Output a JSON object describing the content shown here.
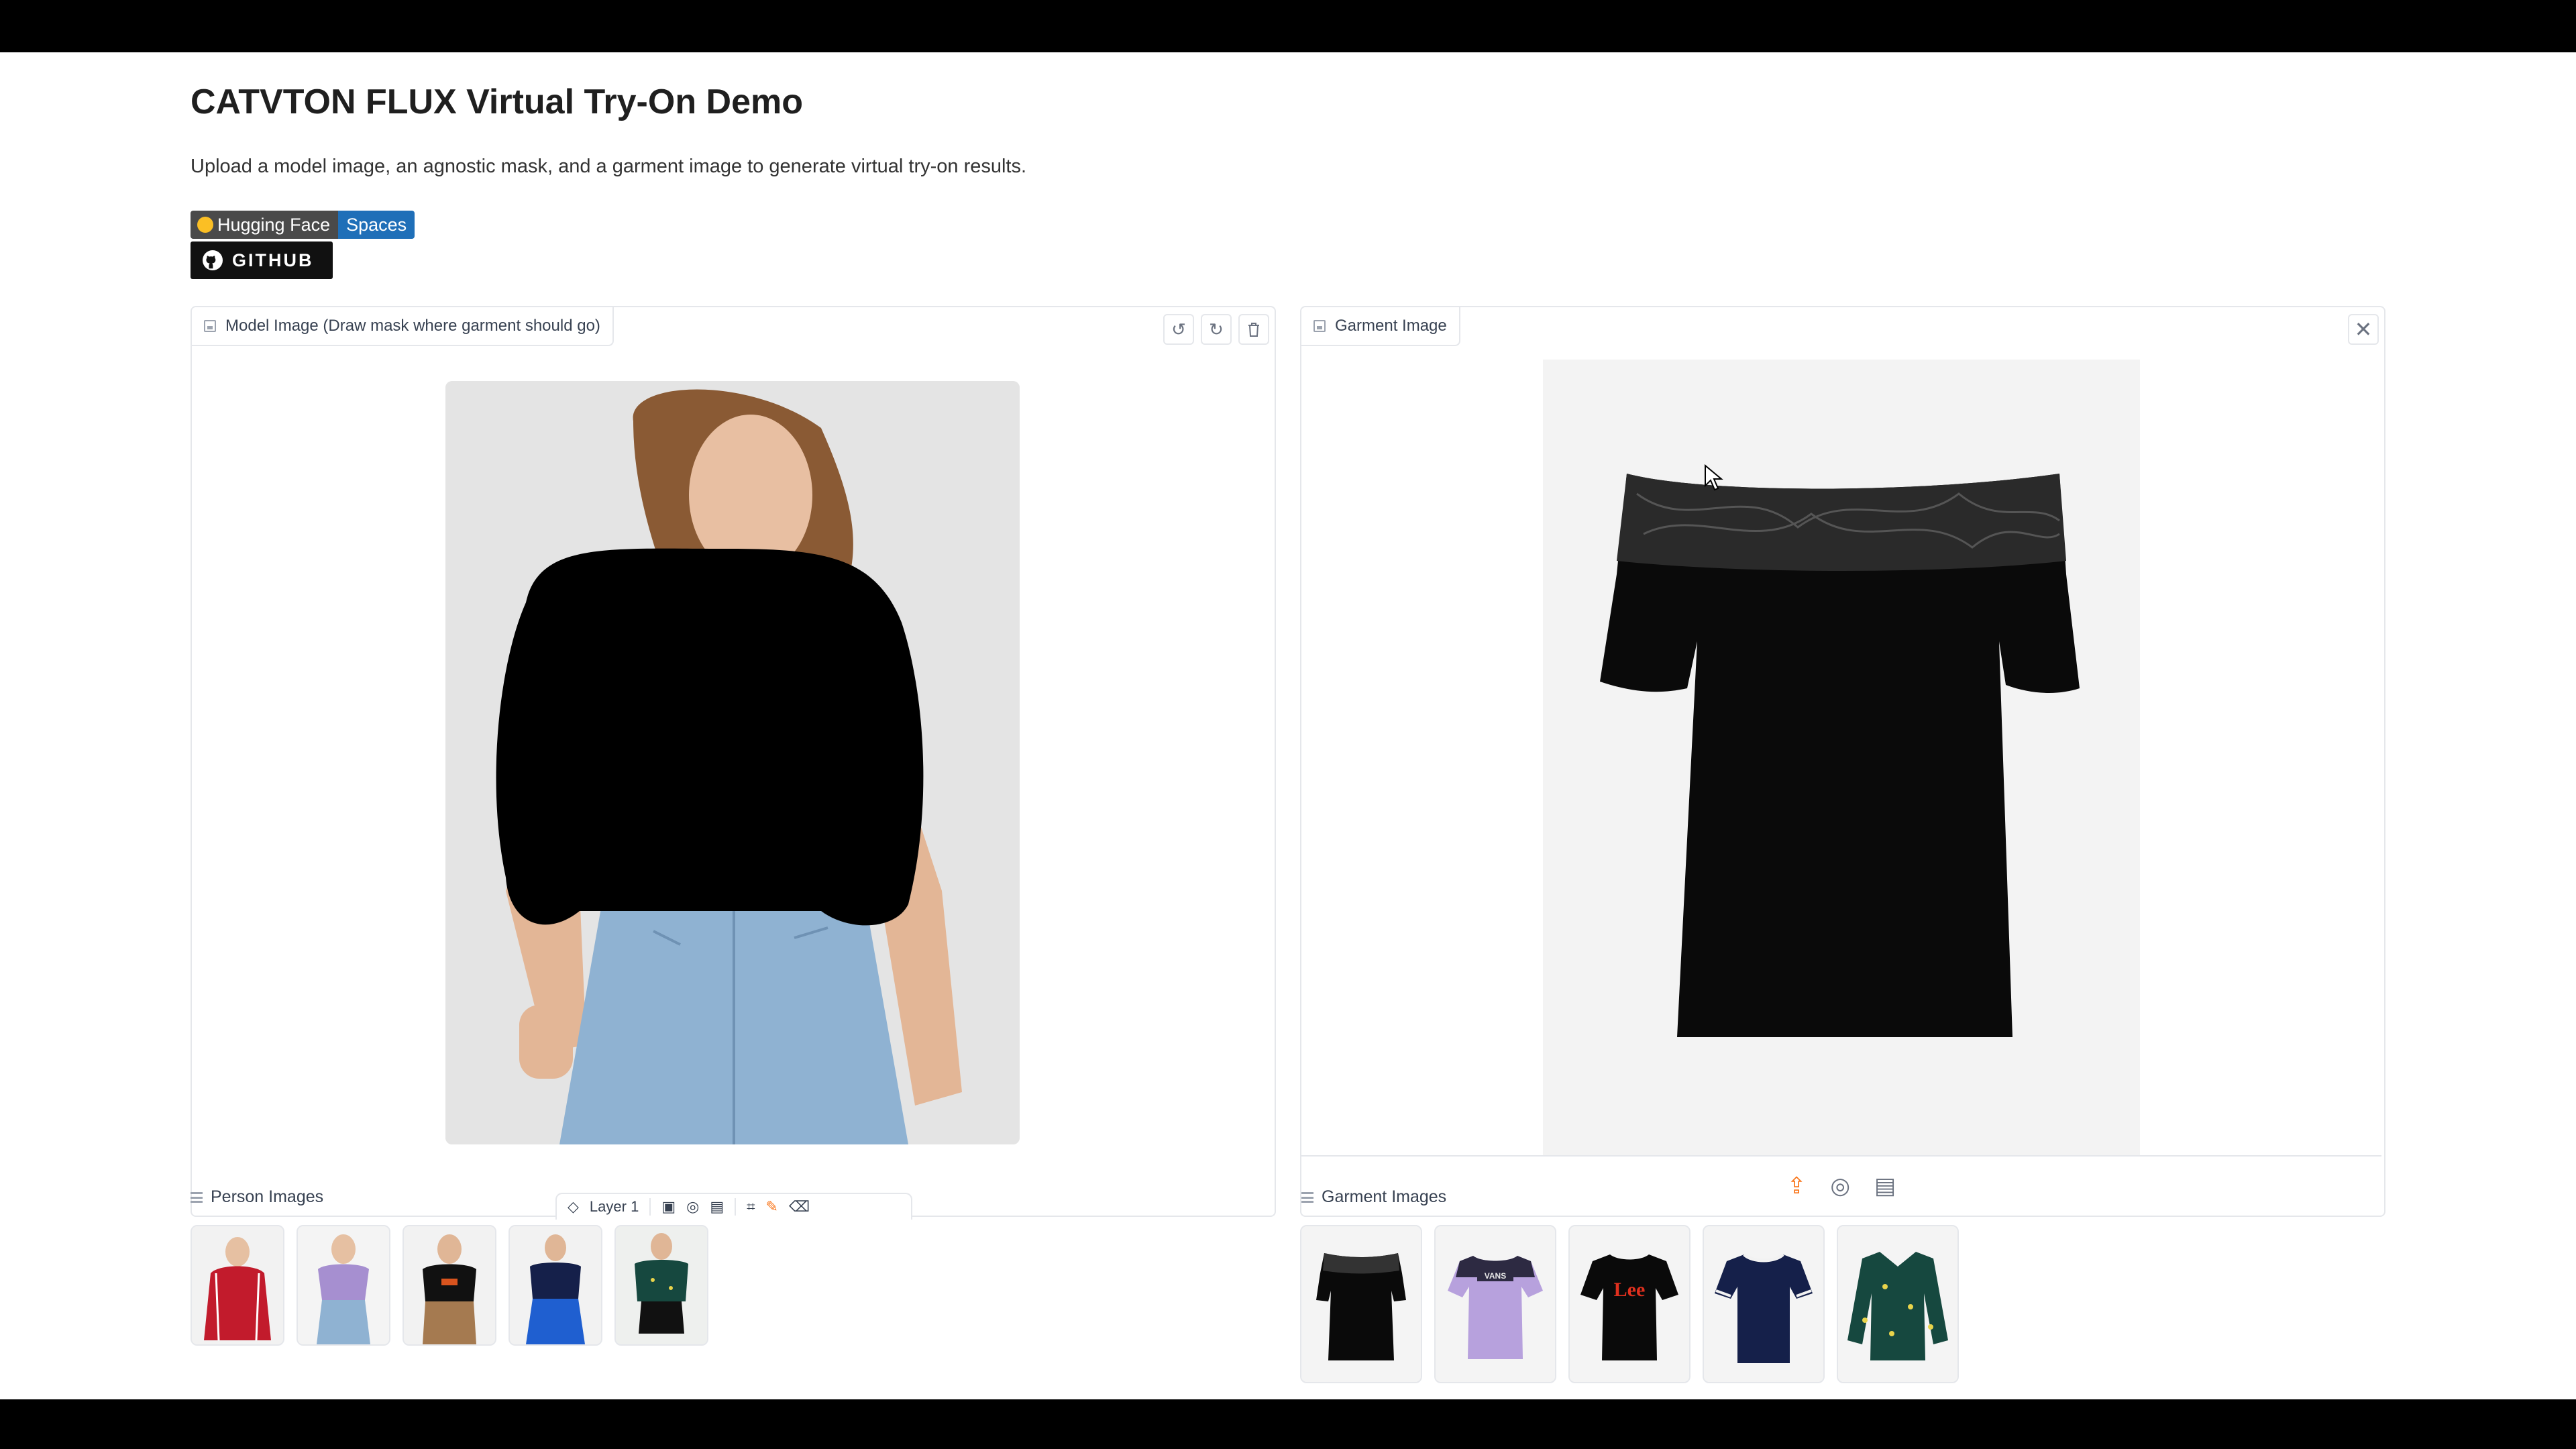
{
  "page": {
    "title": "CATVTON FLUX Virtual Try-On Demo",
    "description": "Upload a model image, an agnostic mask, and a garment image to generate virtual try-on results."
  },
  "badges": {
    "hf_left": "Hugging Face",
    "hf_right": "Spaces",
    "github": "GITHUB"
  },
  "model_panel": {
    "label": "Model Image (Draw mask where garment should go)",
    "tools": [
      "undo-icon",
      "redo-icon",
      "trash-icon"
    ],
    "layer_label": "Layer 1"
  },
  "garment_panel": {
    "label": "Garment Image",
    "close_icon": "close-icon",
    "source_icons": [
      "upload-icon",
      "webcam-icon",
      "clipboard-icon"
    ]
  },
  "person_gallery": {
    "label": "Person Images",
    "items": [
      "red-sweater",
      "lilac-tee",
      "black-lee-tee",
      "navy-tee",
      "green-blouse"
    ]
  },
  "garment_gallery": {
    "label": "Garment Images",
    "items": [
      "black-lace-top",
      "lilac-vans-tee",
      "black-lee-tee",
      "navy-ringer-tee",
      "green-print-blouse"
    ],
    "thumb_texts": [
      "VANS",
      "Lee"
    ]
  },
  "colors": {
    "hf_badge_right": "#1f6fb8",
    "github_badge": "#111111",
    "upload_accent": "#f97316",
    "brush_accent": "#f97316"
  }
}
